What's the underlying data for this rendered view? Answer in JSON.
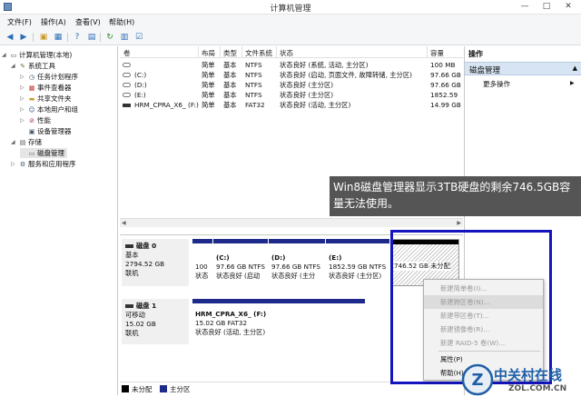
{
  "window": {
    "title": "计算机管理",
    "controls": [
      "—",
      "□",
      "✕"
    ]
  },
  "menubar": [
    "文件(F)",
    "操作(A)",
    "查看(V)",
    "帮助(H)"
  ],
  "tree": {
    "root": "计算机管理(本地)",
    "system_tools": "系统工具",
    "task_scheduler": "任务计划程序",
    "event_viewer": "事件查看器",
    "shared_folders": "共享文件夹",
    "local_users": "本地用户和组",
    "performance": "性能",
    "device_manager": "设备管理器",
    "storage": "存储",
    "disk_management": "磁盘管理",
    "services": "服务和应用程序"
  },
  "volume_table": {
    "headers": [
      "卷",
      "布局",
      "类型",
      "文件系统",
      "状态",
      "容量"
    ],
    "rows": [
      [
        "",
        "简单",
        "基本",
        "NTFS",
        "状态良好 (系统, 活动, 主分区)",
        "100 MB"
      ],
      [
        "(C:)",
        "简单",
        "基本",
        "NTFS",
        "状态良好 (启动, 页面文件, 故障转储, 主分区)",
        "97.66 GB"
      ],
      [
        "(D:)",
        "简单",
        "基本",
        "NTFS",
        "状态良好 (主分区)",
        "97.66 GB"
      ],
      [
        "(E:)",
        "简单",
        "基本",
        "NTFS",
        "状态良好 (主分区)",
        "1852.59"
      ],
      [
        "HRM_CPRA_X6_ (F:)",
        "简单",
        "基本",
        "FAT32",
        "状态良好 (活动, 主分区)",
        "14.99 GB"
      ]
    ]
  },
  "disks": {
    "disk0": {
      "name": "磁盘 0",
      "type": "基本",
      "size": "2794.52 GB",
      "status": "联机",
      "partitions": [
        {
          "title": "",
          "line1": "100",
          "line2": "状态"
        },
        {
          "title": "(C:)",
          "line1": "97.66 GB NTFS",
          "line2": "状态良好 (启动"
        },
        {
          "title": "(D:)",
          "line1": "97.66 GB NTFS",
          "line2": "状态良好 (主分"
        },
        {
          "title": "(E:)",
          "line1": "1852.59 GB NTFS",
          "line2": "状态良好 (主分区)"
        },
        {
          "title": "",
          "line1": "746.52 GB",
          "line2": "未分配"
        }
      ]
    },
    "disk1": {
      "name": "磁盘 1",
      "type": "可移动",
      "size": "15.02 GB",
      "status": "联机",
      "partition": {
        "title": "HRM_CPRA_X6_ (F:)",
        "line1": "15.02 GB FAT32",
        "line2": "状态良好 (活动, 主分区)"
      }
    }
  },
  "legend": {
    "unallocated": "未分配",
    "primary": "主分区"
  },
  "actions": {
    "header": "操作",
    "section": "磁盘管理",
    "more": "更多操作"
  },
  "overlay_text": "Win8磁盘管理器显示3TB硬盘的剩余746.5GB容量无法使用。",
  "context_menu": [
    {
      "label": "新建简单卷(I)...",
      "enabled": false
    },
    {
      "label": "新建跨区卷(N)...",
      "enabled": false
    },
    {
      "label": "新建带区卷(T)...",
      "enabled": false
    },
    {
      "label": "新建镜像卷(R)...",
      "enabled": false
    },
    {
      "label": "新建 RAID-5 卷(W)...",
      "enabled": false
    },
    {
      "label": "属性(P)",
      "enabled": true
    },
    {
      "label": "帮助(H)",
      "enabled": true
    }
  ],
  "watermark": {
    "main": "中关村在线",
    "sub": "ZOL.COM.CN",
    "logo_letter": "Z"
  },
  "colors": {
    "primary_partition": "#1d2a8a",
    "black_bar": "#000000",
    "accent": "#1515c0",
    "action_header": "#d6e4f3"
  }
}
